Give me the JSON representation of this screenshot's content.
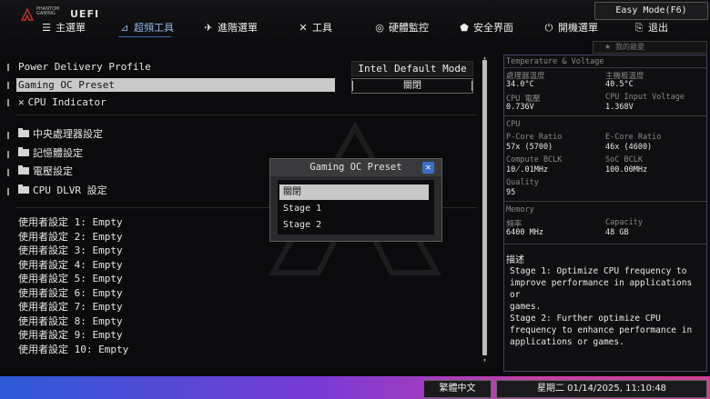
{
  "header": {
    "brand_line1": "PHANTOM",
    "brand_line2": "GAMING",
    "uefi": "UEFI",
    "easy_mode": "Easy Mode(F6)",
    "nav": [
      {
        "label": "主選單",
        "icon": "menu-icon"
      },
      {
        "label": "超頻工具",
        "icon": "oc-tweaker-icon"
      },
      {
        "label": "進階選單",
        "icon": "advanced-icon"
      },
      {
        "label": "工具",
        "icon": "tool-icon"
      },
      {
        "label": "硬體監控",
        "icon": "hardware-monitor-icon"
      },
      {
        "label": "安全界面",
        "icon": "security-icon"
      },
      {
        "label": "開機選單",
        "icon": "boot-icon"
      },
      {
        "label": "退出",
        "icon": "exit-icon"
      }
    ],
    "favorites": "我的最愛"
  },
  "settings": {
    "power_delivery_label": "Power Delivery Profile",
    "power_delivery_value": "Intel Default Mode",
    "gaming_oc_label": "Gaming OC Preset",
    "gaming_oc_value": "關閉",
    "cpu_indicator": "CPU Indicator",
    "folders": [
      "中央處理器設定",
      "記憶體設定",
      "電壓設定",
      "CPU DLVR 設定"
    ],
    "user_settings": [
      "使用者設定 1: Empty",
      "使用者設定 2: Empty",
      "使用者設定 3: Empty",
      "使用者設定 4: Empty",
      "使用者設定 5: Empty",
      "使用者設定 6: Empty",
      "使用者設定 7: Empty",
      "使用者設定 8: Empty",
      "使用者設定 9: Empty",
      "使用者設定 10: Empty"
    ]
  },
  "monitor": {
    "section_temp": "Temperature & Voltage",
    "cpu_temp_label": "處理器溫度",
    "cpu_temp": "34.0°C",
    "mb_temp_label": "主機板溫度",
    "mb_temp": "40.5°C",
    "cpu_volt_label": "CPU 電壓",
    "cpu_volt": "0.736V",
    "cpu_input_label": "CPU Input Voltage",
    "cpu_input": "1.368V",
    "section_cpu": "CPU",
    "pcore_label": "P-Core Ratio",
    "pcore": "57x (5700)",
    "ecore_label": "E-Core Ratio",
    "ecore": "46x (4600)",
    "compute_label": "Compute BCLK",
    "compute": "10̸.01MHz",
    "soc_label": "SoC BCLK",
    "soc": "100.00MHz",
    "quality_label": "Quality",
    "quality": "95",
    "section_mem": "Memory",
    "freq_label": "頻率",
    "freq": "6400 MHz",
    "capacity_label": "Capacity",
    "capacity": "48 GB",
    "desc_title": "描述",
    "desc_text": "Stage 1: Optimize CPU frequency to\nimprove performance in applications or\ngames.\nStage 2: Further optimize CPU\nfrequency to enhance performance in\napplications or games."
  },
  "modal": {
    "title": "Gaming OC Preset",
    "options": [
      "關閉",
      "Stage 1",
      "Stage 2"
    ],
    "selected": "關閉"
  },
  "footer": {
    "language": "繁體中文",
    "datetime": "星期二 01/14/2025, 11:10:48"
  }
}
